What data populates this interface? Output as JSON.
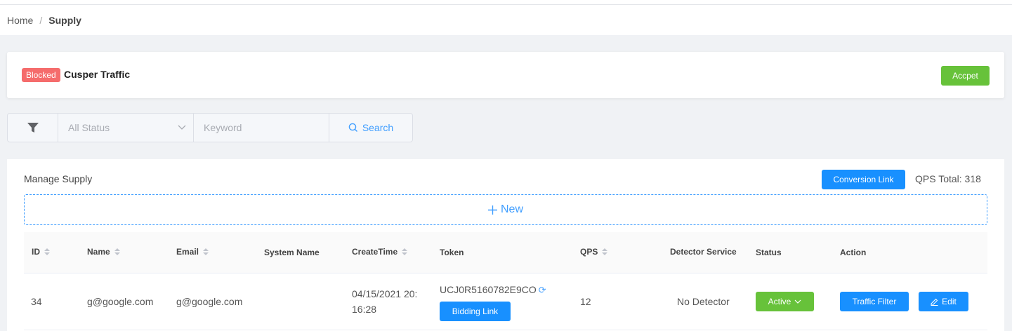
{
  "breadcrumb": {
    "home": "Home",
    "separator": "/",
    "current": "Supply"
  },
  "info_card": {
    "badge": "Blocked",
    "title": "Cusper Traffic",
    "accept_label": "Accpet"
  },
  "filter": {
    "status_placeholder": "All Status",
    "keyword_placeholder": "Keyword",
    "search_label": "Search"
  },
  "manage": {
    "title": "Manage Supply",
    "conversion_link_label": "Conversion Link",
    "qps_total": "QPS Total: 318",
    "new_label": "New"
  },
  "table": {
    "columns": {
      "id": "ID",
      "name": "Name",
      "email": "Email",
      "system_name": "System Name",
      "create_time": "CreateTime",
      "token": "Token",
      "qps": "QPS",
      "detector": "Detector Service",
      "status": "Status",
      "action": "Action"
    },
    "rows": [
      {
        "id": "34",
        "name": "g@google.com",
        "email": "g@google.com",
        "system_name": "",
        "create_time_line1": "04/15/2021 20:",
        "create_time_line2": "16:28",
        "token": "UCJ0R5160782E9CO",
        "bidding_link_label": "Bidding Link",
        "qps": "12",
        "detector": "No Detector",
        "status": "Active",
        "traffic_filter_label": "Traffic Filter",
        "edit_label": "Edit"
      }
    ]
  },
  "colors": {
    "primary": "#1890ff",
    "success": "#67c23a",
    "danger": "#f56c6c",
    "link": "#409eff"
  }
}
